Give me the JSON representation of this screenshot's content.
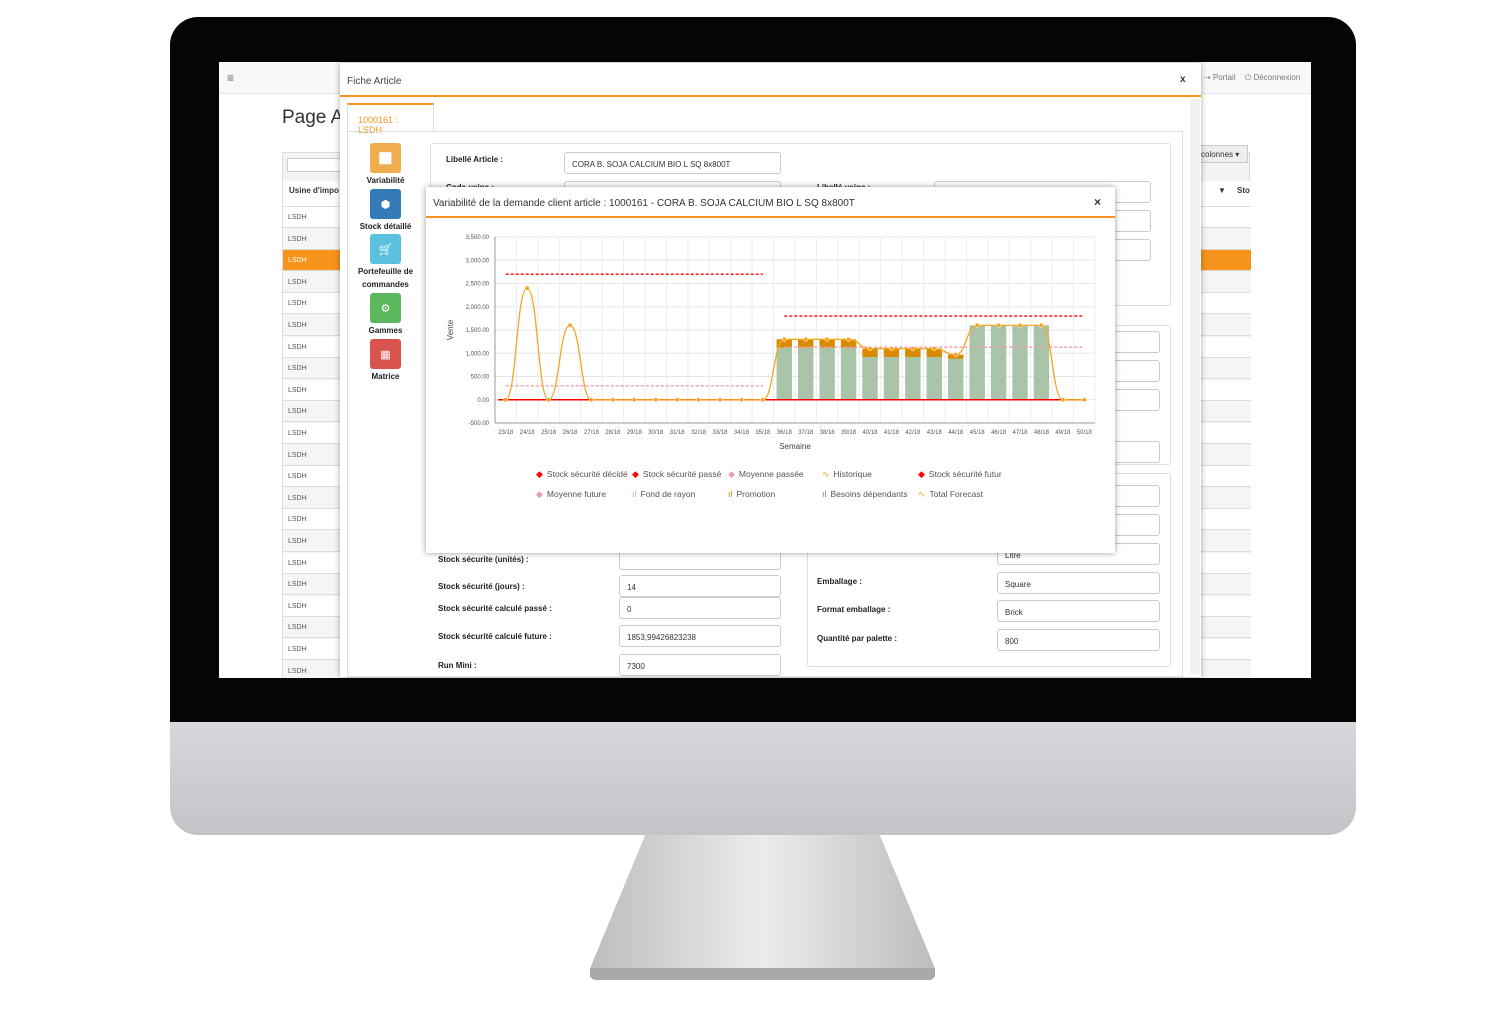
{
  "app": {
    "menu_icon": "hamburger-icon",
    "page_title": "Page A",
    "portal": "Portail",
    "logout": "Déconnexion",
    "columns_btn": "colonnes",
    "col_header_1": "Usine d'impo",
    "col_header_2": "Sto",
    "row_value": "LSDH",
    "rows": 22,
    "selected_row": 2,
    "accent": "#f7941d"
  },
  "fiche": {
    "title": "Fiche Article",
    "close": "x",
    "tab": "1000161 : LSDH",
    "side_buttons": [
      {
        "label": "Variabilité",
        "icon": "chart-icon",
        "color": "#f0ad4e"
      },
      {
        "label": "Stock détaillé",
        "icon": "cube-icon",
        "color": "#337ab7"
      },
      {
        "label": "Portefeuille de commandes",
        "icon": "cart-icon",
        "color": "#5bc0de"
      },
      {
        "label": "Gammes",
        "icon": "gear-icon",
        "color": "#5cb85c"
      },
      {
        "label": "Matrice",
        "icon": "grid-icon",
        "color": "#d9534f"
      }
    ],
    "libelle_label": "Libellé Article :",
    "libelle_value": "CORA B. SOJA CALCIUM BIO L SQ 8x800T",
    "code_usine_label": "Code usine :",
    "libelle_usine_label": "Libellé usine :",
    "left_fields": [
      {
        "label": "Stock sécurite (unités) :",
        "value": ""
      },
      {
        "label": "Stock sécurité (jours) :",
        "value": "14"
      },
      {
        "label": "Stock sécurité calculé passé :",
        "value": "0"
      },
      {
        "label": "Stock sécurité calculé future :",
        "value": "1853,99426823238"
      },
      {
        "label": "Run Mini :",
        "value": "7300"
      }
    ],
    "right_fields": [
      {
        "label": "",
        "value": "Litre"
      },
      {
        "label": "Emballage :",
        "value": "Square"
      },
      {
        "label": "Format emballage :",
        "value": "Brick"
      },
      {
        "label": "Quantité par palette :",
        "value": "800"
      }
    ]
  },
  "variability": {
    "title": "Variabilité de la demande client article : 1000161 - CORA B. SOJA CALCIUM BIO L SQ 8x800T",
    "close": "×"
  },
  "chart_data": {
    "type": "bar",
    "xlabel": "Semaine",
    "ylabel": "Vente",
    "ylim": [
      -500,
      3500
    ],
    "yticks": [
      "-500.00",
      "0.00",
      "500.00",
      "1,000.00",
      "1,500.00",
      "2,000.00",
      "2,500.00",
      "3,000.00",
      "3,500.00"
    ],
    "ytick_values": [
      -500,
      0,
      500,
      1000,
      1500,
      2000,
      2500,
      3000,
      3500
    ],
    "grid": true,
    "legend_position": "bottom",
    "categories": [
      "23/18",
      "24/18",
      "25/18",
      "26/18",
      "27/18",
      "28/18",
      "29/18",
      "30/18",
      "31/18",
      "32/18",
      "33/18",
      "34/18",
      "35/18",
      "36/18",
      "37/18",
      "38/18",
      "39/18",
      "40/18",
      "41/18",
      "42/18",
      "43/18",
      "44/18",
      "45/18",
      "46/18",
      "47/18",
      "48/18",
      "49/18",
      "50/18"
    ],
    "series": [
      {
        "name": "Stock sécurité décidé",
        "kind": "line",
        "color": "#ff0000",
        "values": [
          0,
          0,
          0,
          0,
          0,
          0,
          0,
          0,
          0,
          0,
          0,
          0,
          0,
          0,
          0,
          0,
          0,
          0,
          0,
          0,
          0,
          0,
          0,
          0,
          0,
          0,
          0,
          0
        ]
      },
      {
        "name": "Stock sécurité passé",
        "kind": "dashed",
        "color": "#ff0000",
        "values": [
          2700,
          2700,
          2700,
          2700,
          2700,
          2700,
          2700,
          2700,
          2700,
          2700,
          2700,
          2700,
          2700,
          null,
          null,
          null,
          null,
          null,
          null,
          null,
          null,
          null,
          null,
          null,
          null,
          null,
          null,
          null
        ]
      },
      {
        "name": "Moyenne passée",
        "kind": "dashed",
        "color": "#e8a0a8",
        "values": [
          300,
          300,
          300,
          300,
          300,
          300,
          300,
          300,
          300,
          300,
          300,
          300,
          300,
          null,
          null,
          null,
          null,
          null,
          null,
          null,
          null,
          null,
          null,
          null,
          null,
          null,
          null,
          null
        ]
      },
      {
        "name": "Historique",
        "kind": "spline",
        "color": "#f5a623",
        "values": [
          0,
          2400,
          0,
          1600,
          0,
          0,
          0,
          0,
          0,
          0,
          0,
          0,
          0,
          null,
          null,
          null,
          null,
          null,
          null,
          null,
          null,
          null,
          null,
          null,
          null,
          null,
          null,
          null
        ]
      },
      {
        "name": "Stock sécurité futur",
        "kind": "dashed",
        "color": "#ff0000",
        "values": [
          null,
          null,
          null,
          null,
          null,
          null,
          null,
          null,
          null,
          null,
          null,
          null,
          null,
          1800,
          1800,
          1800,
          1800,
          1800,
          1800,
          1800,
          1800,
          1800,
          1800,
          1800,
          1800,
          1800,
          1800,
          1800
        ]
      },
      {
        "name": "Moyenne future",
        "kind": "dashed",
        "color": "#e8a0a8",
        "values": [
          null,
          null,
          null,
          null,
          null,
          null,
          null,
          null,
          null,
          null,
          null,
          null,
          null,
          1130,
          1130,
          1130,
          1130,
          1130,
          1130,
          1130,
          1130,
          1130,
          1130,
          1130,
          1130,
          1130,
          1130,
          1130
        ]
      },
      {
        "name": "Fond de rayon",
        "kind": "bar",
        "color": "#a9c4a8",
        "values": [
          null,
          null,
          null,
          null,
          null,
          null,
          null,
          null,
          null,
          null,
          null,
          null,
          null,
          1120,
          1120,
          1120,
          1120,
          920,
          920,
          920,
          920,
          880,
          1600,
          1600,
          1600,
          1600,
          null,
          null
        ]
      },
      {
        "name": "Promotion",
        "kind": "bar",
        "color": "#d98a00",
        "values": [
          null,
          null,
          null,
          null,
          null,
          null,
          null,
          null,
          null,
          null,
          null,
          null,
          null,
          180,
          180,
          180,
          180,
          180,
          180,
          180,
          180,
          90,
          0,
          0,
          0,
          0,
          null,
          null
        ]
      },
      {
        "name": "Besoins dépendants",
        "kind": "bar",
        "color": "#6b8fa8",
        "values": [
          null,
          null,
          null,
          null,
          null,
          null,
          null,
          null,
          null,
          null,
          null,
          null,
          null,
          0,
          0,
          0,
          0,
          0,
          0,
          0,
          0,
          0,
          0,
          0,
          0,
          0,
          null,
          null
        ]
      },
      {
        "name": "Total Forecast",
        "kind": "spline",
        "color": "#f5a623",
        "values": [
          null,
          null,
          null,
          null,
          null,
          null,
          null,
          null,
          null,
          null,
          null,
          null,
          0,
          1300,
          1300,
          1300,
          1300,
          1100,
          1100,
          1100,
          1100,
          970,
          1600,
          1600,
          1600,
          1600,
          0,
          0
        ]
      }
    ]
  }
}
